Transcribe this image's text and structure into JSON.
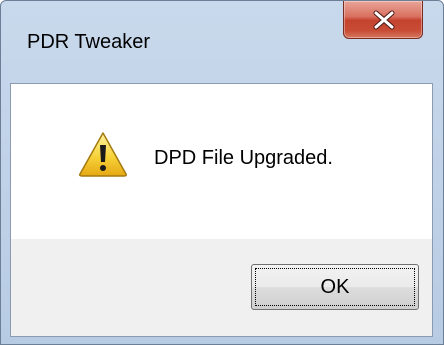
{
  "window": {
    "title": "PDR Tweaker"
  },
  "dialog": {
    "message": "DPD File Upgraded.",
    "icon": "warning-icon",
    "ok_label": "OK"
  },
  "colors": {
    "close_button": "#c84c35",
    "frame": "#b7cbe3",
    "footer": "#f0f0f0"
  }
}
